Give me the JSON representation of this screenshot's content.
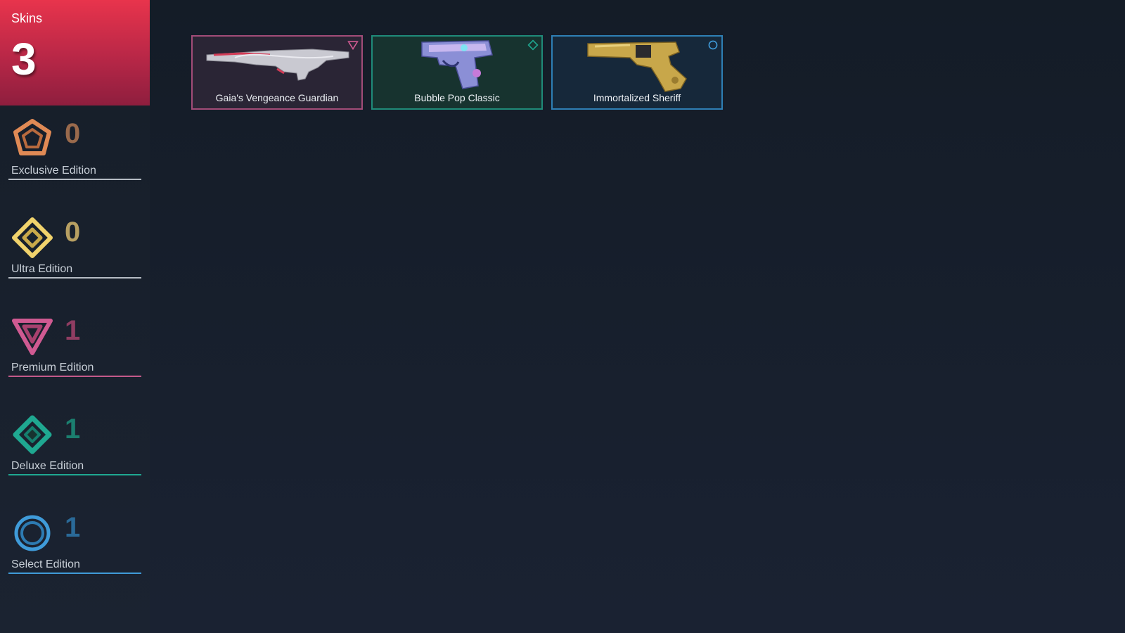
{
  "summary": {
    "label": "Skins",
    "total": "3",
    "accent": "#d9304a"
  },
  "tiers": [
    {
      "key": "exclusive",
      "label": "Exclusive Edition",
      "count": "0",
      "color": "#e08a55",
      "icon": "exclusive-edition-pentagon-icon"
    },
    {
      "key": "ultra",
      "label": "Ultra Edition",
      "count": "0",
      "color": "#f1d36c",
      "icon": "ultra-edition-diamond-icon"
    },
    {
      "key": "premium",
      "label": "Premium Edition",
      "count": "1",
      "color": "#d05a92",
      "icon": "premium-edition-triangle-icon"
    },
    {
      "key": "deluxe",
      "label": "Deluxe Edition",
      "count": "1",
      "color": "#1fa891",
      "icon": "deluxe-edition-diamond-icon"
    },
    {
      "key": "select",
      "label": "Select Edition",
      "count": "1",
      "color": "#3f9bd9",
      "icon": "select-edition-ring-icon"
    }
  ],
  "skins": [
    {
      "name": "Gaia's Vengeance Guardian",
      "tier": "premium",
      "border": "#a24c78",
      "bg": "#2a2535",
      "weapon": "guardian-rifle-icon"
    },
    {
      "name": "Bubble Pop Classic",
      "tier": "deluxe",
      "border": "#1f8b79",
      "bg": "#17332f",
      "weapon": "classic-pistol-icon"
    },
    {
      "name": "Immortalized Sheriff",
      "tier": "select",
      "border": "#2e7fb5",
      "bg": "#16283a",
      "weapon": "sheriff-revolver-icon"
    }
  ]
}
